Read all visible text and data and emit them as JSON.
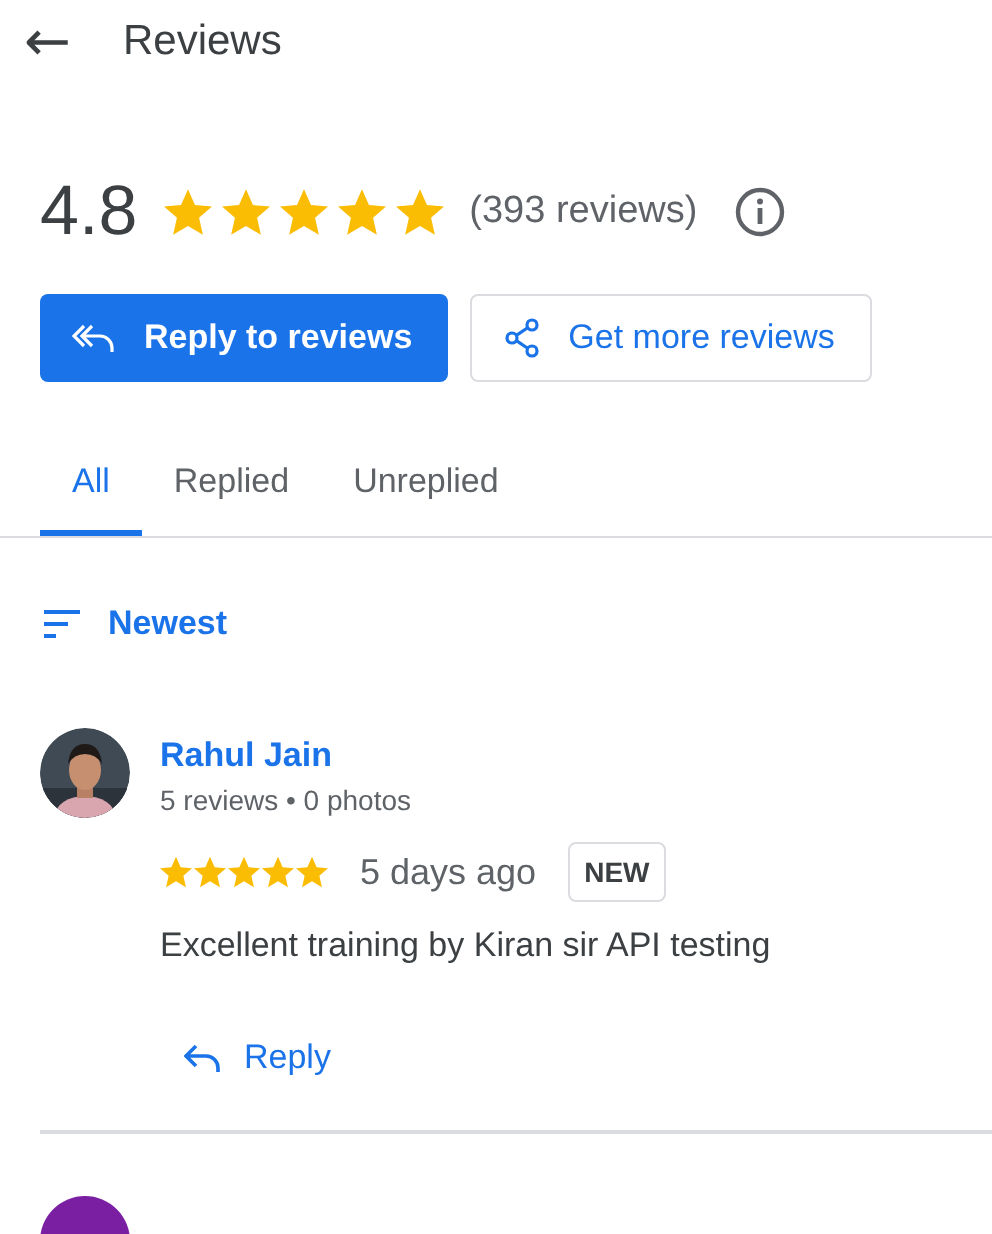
{
  "header": {
    "back_icon": "←",
    "title": "Reviews"
  },
  "rating": {
    "score": "4.8",
    "stars": 5,
    "count": "(393 reviews)"
  },
  "actions": [
    {
      "kind": "primary",
      "label": "Reply to reviews"
    },
    {
      "kind": "outline",
      "label": "Get more reviews"
    }
  ],
  "tabs": [
    {
      "label": "All",
      "selected": true
    },
    {
      "label": "Replied",
      "selected": false
    },
    {
      "label": "Unreplied",
      "selected": false
    }
  ],
  "sort": {
    "label": "Newest"
  },
  "reviews": [
    {
      "kind": "full",
      "name": "Rahul Jain",
      "meta": "5 reviews • 0 photos",
      "stars": 5,
      "time": "5 days ago",
      "badge": "NEW",
      "text": "Excellent training by Kiran sir API testing",
      "reply": "Reply"
    },
    {
      "kind": "partial",
      "color": "#7b1fa2"
    }
  ]
}
